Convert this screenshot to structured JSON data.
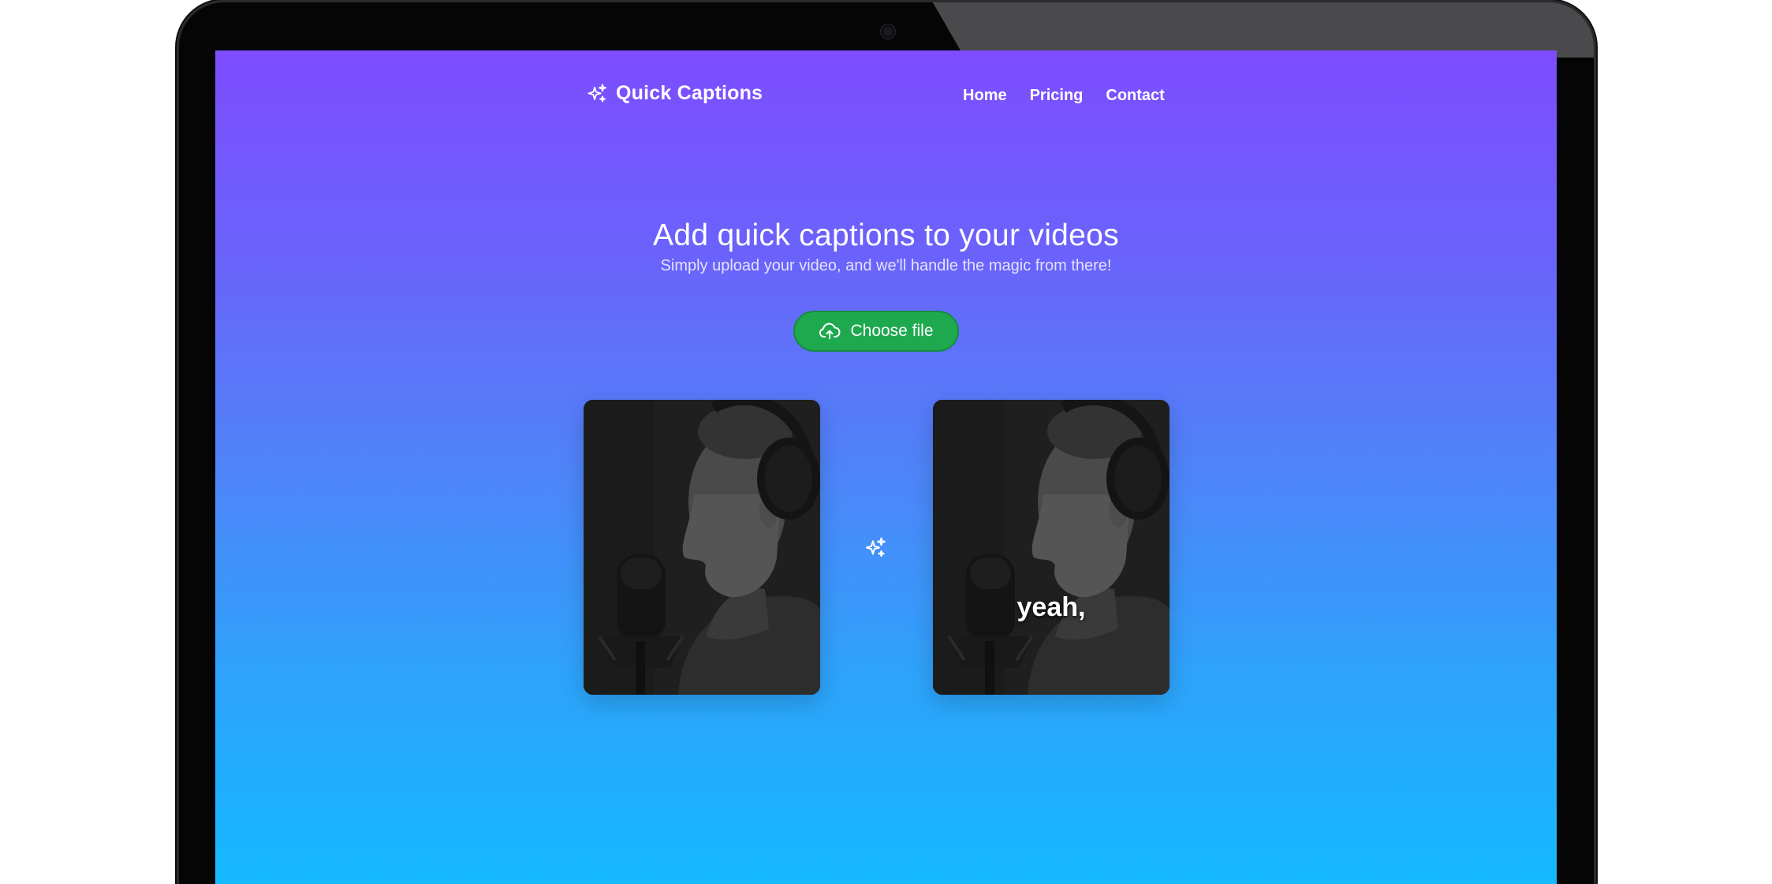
{
  "brand": {
    "name": "Quick Captions",
    "icon": "sparkles-icon"
  },
  "nav": {
    "items": [
      {
        "label": "Home"
      },
      {
        "label": "Pricing"
      },
      {
        "label": "Contact"
      }
    ]
  },
  "hero": {
    "title": "Add quick captions to your videos",
    "subtitle": "Simply upload your video, and we'll handle the magic from there!"
  },
  "upload": {
    "button_label": "Choose file",
    "icon": "cloud-upload-icon",
    "color": "#1ea94f"
  },
  "preview": {
    "before_icon": "sparkles-icon",
    "caption_text": "yeah,"
  },
  "colors": {
    "gradient_top": "#7d4dff",
    "gradient_bottom": "#14b9ff"
  }
}
